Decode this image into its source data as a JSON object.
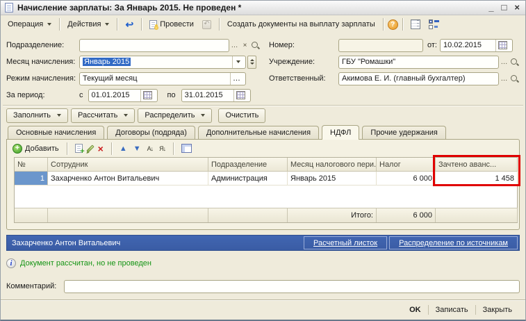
{
  "colors": {
    "accent": "#4166B2",
    "red": "#E00000",
    "green": "#149414",
    "selection": "#6B96CC"
  },
  "window": {
    "title": "Начисление зарплаты: За Январь 2015. Не проведен *",
    "minimize": "_",
    "maximize": "□",
    "close": "×"
  },
  "toolbar": {
    "operation_label": "Операция",
    "actions_label": "Действия",
    "post_label": "Провести",
    "create_docs_label": "Создать документы на выплату зарплаты",
    "help_glyph": "?"
  },
  "fields": {
    "department_label": "Подразделение:",
    "department_value": "",
    "month_label": "Месяц начисления:",
    "month_value": "Январь 2015",
    "mode_label": "Режим начисления:",
    "mode_value": "Текущий месяц",
    "period_label": "За период:",
    "period_from_label": "с",
    "period_from": "01.01.2015",
    "period_to_label": "по",
    "period_to": "31.01.2015",
    "number_label": "Номер:",
    "number_value": "",
    "date_label": "от:",
    "date_value": "10.02.2015",
    "institution_label": "Учреждение:",
    "institution_value": "ГБУ \"Ромашки\"",
    "responsible_label": "Ответственный:",
    "responsible_value": "Акимова Е. И. (главный бухгалтер)"
  },
  "commands": {
    "fill": "Заполнить",
    "calculate": "Рассчитать",
    "distribute": "Распределить",
    "clear": "Очистить"
  },
  "tabs": [
    {
      "label": "Основные начисления",
      "active": false
    },
    {
      "label": "Договоры (подряда)",
      "active": false
    },
    {
      "label": "Дополнительные начисления",
      "active": false
    },
    {
      "label": "НДФЛ",
      "active": true
    },
    {
      "label": "Прочие удержания",
      "active": false
    }
  ],
  "grid_toolbar": {
    "add_label": "Добавить",
    "sort_asc_glyph": "А↓",
    "sort_desc_glyph": "Я↓"
  },
  "table": {
    "columns": [
      "№",
      "Сотрудник",
      "Подразделение",
      "Месяц налогового пери...",
      "Налог",
      "Зачтено аванс..."
    ],
    "row": {
      "num": "1",
      "employee": "Захарченко Антон Витальевич",
      "department": "Администрация",
      "month": "Январь 2015",
      "tax": "6 000",
      "advance": "1 458"
    },
    "total_label": "Итого:",
    "total_tax": "6 000",
    "total_advance": ""
  },
  "infobar": {
    "employee": "Захарченко Антон Витальевич",
    "link_payslip": "Расчетный листок",
    "link_distribution": "Распределение по источникам"
  },
  "status_text": "Документ рассчитан, но не проведен",
  "comment_label": "Комментарий:",
  "comment_value": "",
  "footer_buttons": {
    "ok": "OK",
    "save": "Записать",
    "close": "Закрыть"
  },
  "glyphs": {
    "ellipsis": "…",
    "clear": "×",
    "navigate": "↩",
    "undo_post": "↶",
    "info": "i",
    "add_plus": "+",
    "delete_x": "×",
    "up": "▲",
    "down": "▼"
  }
}
